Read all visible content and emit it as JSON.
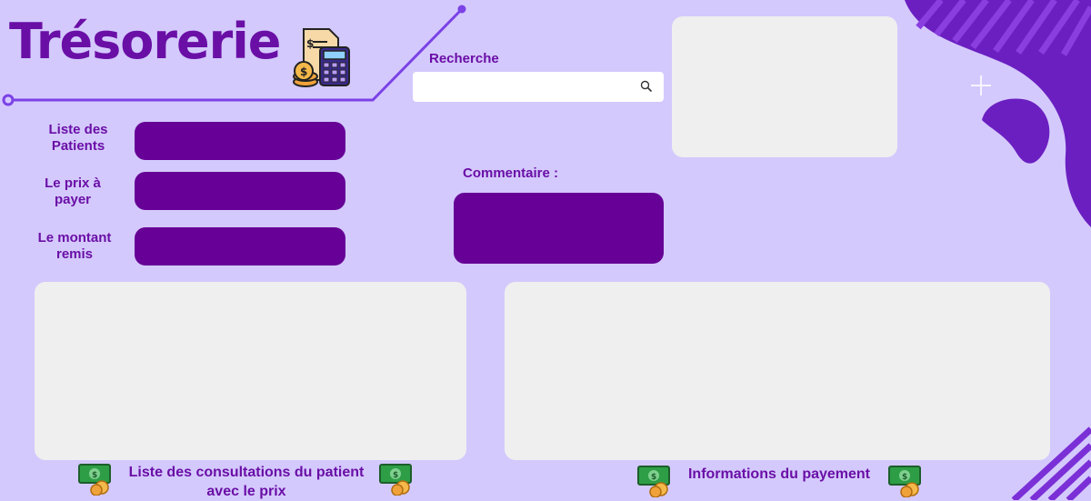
{
  "page": {
    "title": "Trésorerie"
  },
  "search": {
    "label": "Recherche",
    "placeholder": ""
  },
  "form": {
    "patients_label": "Liste des Patients",
    "price_label": "Le prix à payer",
    "amount_label": "Le montant remis",
    "comment_label": "Commentaire :"
  },
  "captions": {
    "consultations": "Liste des consultations du patient avec le prix",
    "payment": "Informations du payement"
  },
  "icons": {
    "title": "receipt-calculator-icon",
    "search": "search-icon",
    "money": "money-bill-coins-icon"
  },
  "colors": {
    "background": "#d4c9fd",
    "accent": "#660096",
    "text": "#6a0fa6",
    "panel": "#efefef"
  }
}
